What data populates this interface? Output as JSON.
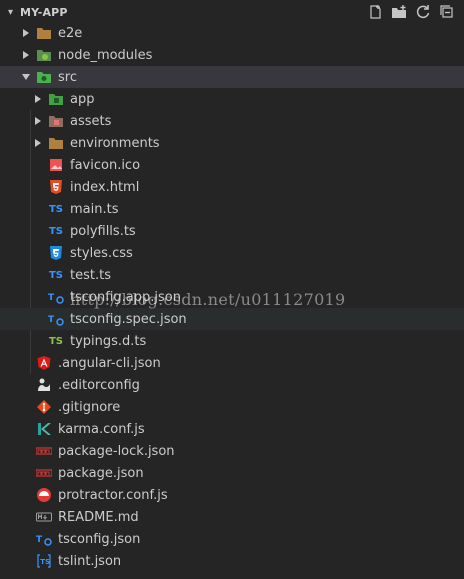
{
  "explorer": {
    "title": "MY-APP",
    "actions": [
      {
        "name": "new-file-icon"
      },
      {
        "name": "new-folder-icon"
      },
      {
        "name": "refresh-icon"
      },
      {
        "name": "collapse-all-icon"
      }
    ]
  },
  "tree": {
    "e2e": "e2e",
    "node_modules": "node_modules",
    "src": "src",
    "app": "app",
    "assets": "assets",
    "environments": "environments",
    "favicon": "favicon.ico",
    "index_html": "index.html",
    "main_ts": "main.ts",
    "polyfills_ts": "polyfills.ts",
    "styles_css": "styles.css",
    "test_ts": "test.ts",
    "tsconfig_app": "tsconfig.app.json",
    "tsconfig_spec": "tsconfig.spec.json",
    "typings": "typings.d.ts",
    "angular_cli": ".angular-cli.json",
    "editorconfig": ".editorconfig",
    "gitignore": ".gitignore",
    "karma": "karma.conf.js",
    "package_lock": "package-lock.json",
    "package": "package.json",
    "protractor": "protractor.conf.js",
    "readme": "README.md",
    "tsconfig": "tsconfig.json",
    "tslint": "tslint.json"
  },
  "badges": {
    "ts": "TS"
  },
  "watermark": "http://blog.csdn.net/u011127019"
}
